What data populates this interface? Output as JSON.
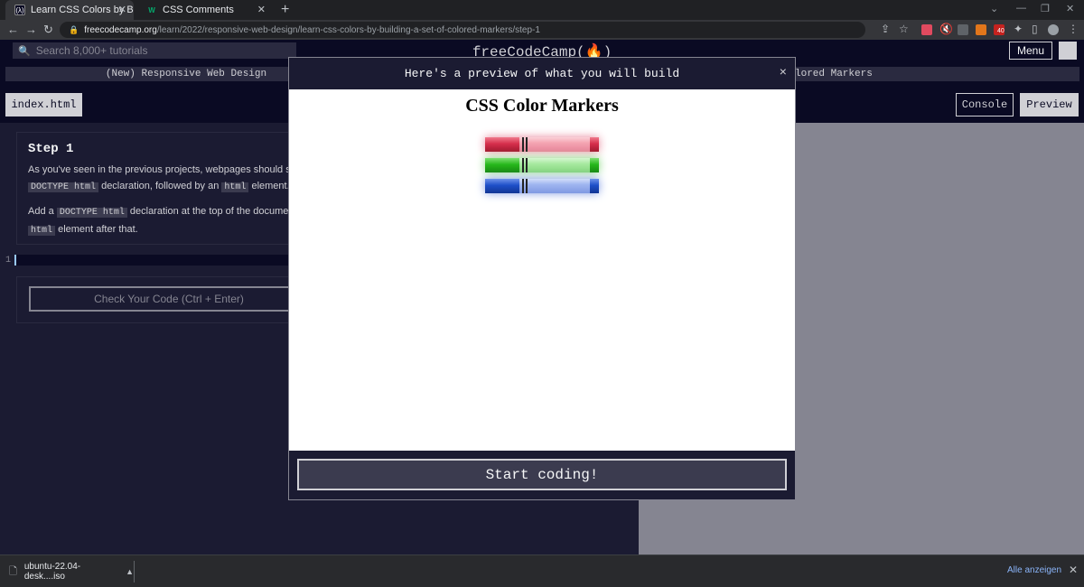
{
  "browser": {
    "tabs": [
      {
        "title": "Learn CSS Colors by Building a S",
        "favicon": "freecodecamp-icon",
        "active": true
      },
      {
        "title": "CSS Comments",
        "favicon": "w3schools-icon",
        "active": false
      }
    ],
    "new_tab": "+",
    "address": {
      "host": "freecodecamp.org",
      "path": "/learn/2022/responsive-web-design/learn-css-colors-by-building-a-set-of-colored-markers/step-1"
    },
    "ext_badge": "40"
  },
  "fcc": {
    "search_placeholder": "Search 8,000+ tutorials",
    "logo": "freeCodeCamp(🔥)",
    "menu_label": "Menu",
    "breadcrumb_left": "(New) Responsive Web Design",
    "breadcrumb_right": "lored Markers",
    "file_tab": "index.html",
    "console_label": "Console",
    "preview_label": "Preview"
  },
  "lesson": {
    "step_title": "Step 1",
    "p1_a": "As you've seen in the previous projects, webpages should st",
    "p1_code1": "DOCTYPE html",
    "p1_b": " declaration, followed by an ",
    "p1_code2": "html",
    "p1_c": " element.",
    "p2_a": "Add a ",
    "p2_code1": "DOCTYPE html",
    "p2_b": " declaration at the top of the docume",
    "p2_code2": "html",
    "p2_c": " element after that.",
    "line_number": "1",
    "check_button": "Check Your Code (Ctrl + Enter)"
  },
  "modal": {
    "header": "Here's a preview of what you will build",
    "close": "×",
    "preview_title": "CSS Color Markers",
    "start_button": "Start coding!",
    "markers": [
      {
        "name": "red",
        "cap": "#d62f4c",
        "barrel": "#f4a3b1",
        "tip": "#d62f4c"
      },
      {
        "name": "green",
        "cap": "#27b81c",
        "barrel": "#a7e9a0",
        "tip": "#27b81c"
      },
      {
        "name": "blue",
        "cap": "#1e4fc9",
        "barrel": "#9fb5f0",
        "tip": "#1e4fc9"
      }
    ]
  },
  "downloads": {
    "file": "ubuntu-22.04-desk....iso",
    "show_all": "Alle anzeigen"
  },
  "colors": {
    "fcc_dark": "#0a0a23",
    "fcc_panel": "#1b1b32",
    "fcc_gray": "#858591"
  }
}
